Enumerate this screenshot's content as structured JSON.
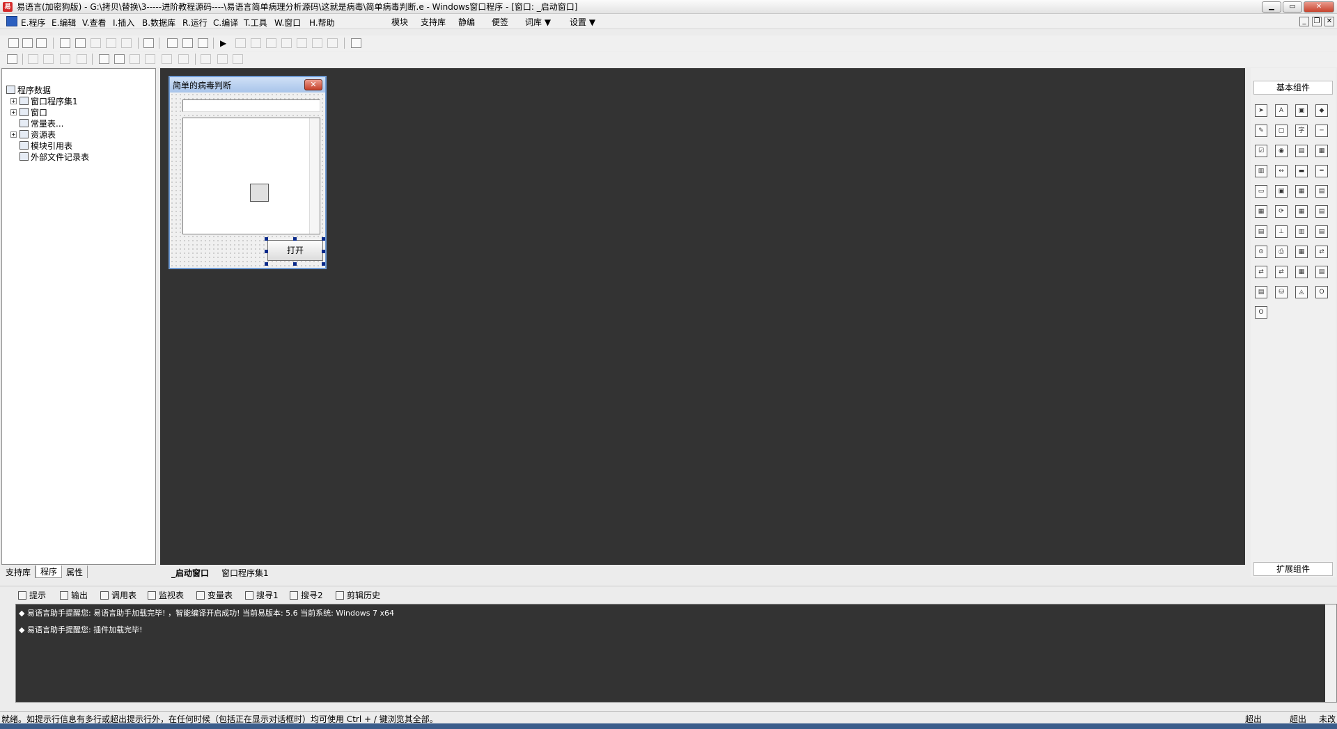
{
  "window": {
    "title": "易语言(加密狗版) - G:\\拷贝\\替换\\3-----进阶教程源码----\\易语言简单病理分析源码\\这就是病毒\\简单病毒判断.e - Windows窗口程序 - [窗口: _启动窗口]",
    "icon_text": "易",
    "min_label": "▁",
    "max_label": "▭",
    "close_label": "✕"
  },
  "menu": {
    "items": [
      "E.程序",
      "E.编辑",
      "V.查看",
      "I.插入",
      "B.数据库",
      "R.运行",
      "C.编译",
      "T.工具",
      "W.窗口",
      "H.帮助"
    ],
    "extras": [
      "模块",
      "支持库",
      "静编",
      "便签",
      "词库 ▼",
      "设置 ▼"
    ],
    "mdi": [
      "_",
      "❐",
      "✕"
    ]
  },
  "left_panel": {
    "tree": [
      {
        "label": "程序数据",
        "expander": ""
      },
      {
        "label": "窗口程序集1",
        "expander": "+"
      },
      {
        "label": "窗口",
        "expander": "+"
      },
      {
        "label": "常量表...",
        "expander": ""
      },
      {
        "label": "资源表",
        "expander": "+"
      },
      {
        "label": "模块引用表",
        "expander": ""
      },
      {
        "label": "外部文件记录表",
        "expander": ""
      }
    ],
    "tabs": [
      "支持库",
      "程序",
      "属性"
    ]
  },
  "design_window": {
    "title": "简单的病毒判断",
    "close_label": "✕",
    "button_label": "打开"
  },
  "design_tabs": [
    "_启动窗口",
    "窗口程序集1"
  ],
  "right_panel": {
    "title": "基本组件",
    "ext_label": "扩展组件",
    "components": [
      "arrow-icon",
      "label-icon",
      "picture-icon",
      "shape-icon",
      "edit-icon",
      "frame-icon",
      "text-icon",
      "line-icon",
      "checkbox-icon",
      "radio-icon",
      "listbox-icon",
      "combobox-icon",
      "grid-icon",
      "scrollbar-icon",
      "progress-icon",
      "slider-icon",
      "ruler-icon",
      "tab-icon",
      "image-icon",
      "calendar-icon",
      "datagrid-icon",
      "button-icon",
      "folder-icon",
      "file-icon",
      "toolbar-icon",
      "treeview-icon",
      "list-icon",
      "printer-icon",
      "timer-icon",
      "printer2-icon",
      "network-icon",
      "socket-icon",
      "server-icon",
      "client-icon",
      "port-icon",
      "database-icon",
      "db-icon",
      "db2-icon",
      "chart-icon",
      "odbc-icon",
      "odbc2-icon"
    ],
    "component_glyphs": [
      "➤",
      "A",
      "▣",
      "◆",
      "✎",
      "▢",
      "字",
      "─",
      "☑",
      "◉",
      "▤",
      "▦",
      "▥",
      "↔",
      "▬",
      "═",
      "▭",
      "▣",
      "▦",
      "▤",
      "▦",
      "⟳",
      "▦",
      "▤",
      "▤",
      "⊥",
      "▥",
      "▤",
      "⊙",
      "⎙",
      "▦",
      "⇄",
      "⇄",
      "⇄",
      "▦",
      "▤",
      "▤",
      "⛁",
      "◬",
      "O",
      "O"
    ]
  },
  "output_tabs": [
    "提示",
    "输出",
    "调用表",
    "监视表",
    "变量表",
    "搜寻1",
    "搜寻2",
    "剪辑历史"
  ],
  "output_lines": [
    "◆ 易语言助手提醒您: 易语言助手加载完毕! ，智能编译开启成功! 当前易版本: 5.6  当前系统: Windows 7 x64",
    "◆ 易语言助手提醒您: 插件加载完毕!"
  ],
  "status": {
    "text": "就绪。如提示行信息有多行或超出提示行外，在任何时候（包括正在显示对话框时）均可使用 Ctrl + / 键浏览其全部。",
    "right": [
      "超出",
      "超出",
      "未改"
    ]
  },
  "colors": {
    "canvas": "#333333",
    "output_bg": "#333333",
    "title_accent": "#6f9bd4"
  }
}
